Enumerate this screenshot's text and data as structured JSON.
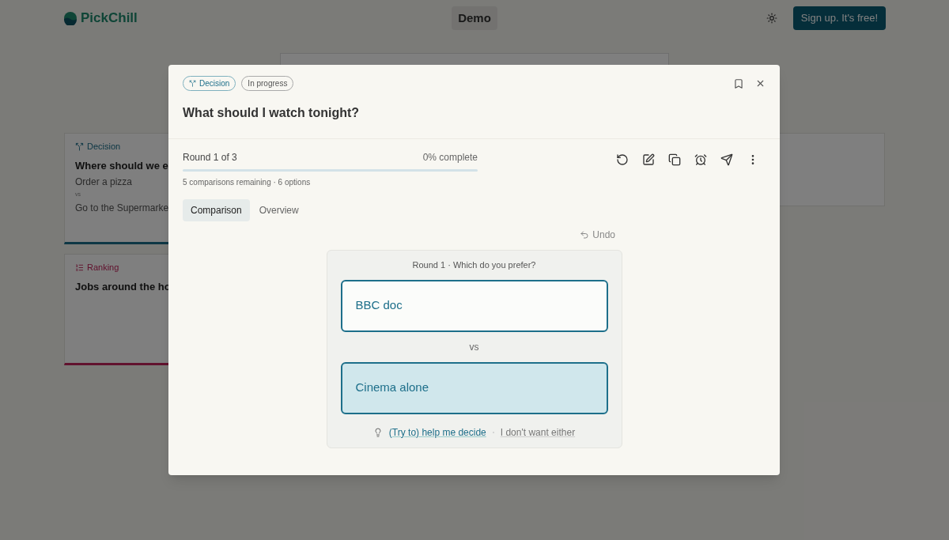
{
  "header": {
    "logo": "PickChill",
    "title": "Demo",
    "signup": "Sign up. It's free!"
  },
  "background_cards": [
    {
      "kind": "decision",
      "tag": "Decision",
      "title": "Where should we e",
      "lines": [
        "Order a pizza",
        "vs",
        "Go to the Supermarke"
      ]
    },
    {
      "kind": "ranking",
      "tag": "Ranking",
      "title": "Jobs around the ho"
    }
  ],
  "modal": {
    "tags": [
      {
        "kind": "decision",
        "label": "Decision"
      },
      {
        "kind": "status",
        "label": "In progress"
      }
    ],
    "title": "What should I watch tonight?",
    "progress": {
      "round": "Round 1 of 3",
      "complete": "0% complete",
      "level": 0,
      "detail": "5 comparisons remaining · 6 options"
    },
    "tabs": [
      {
        "label": "Comparison",
        "selected": true
      },
      {
        "label": "Overview",
        "selected": false
      }
    ],
    "undo": "Undo",
    "comparison": {
      "prompt": "Round 1 · Which do you prefer?",
      "options": [
        {
          "label": "BBC doc",
          "selected": false
        },
        {
          "label": "Cinema alone",
          "selected": true
        }
      ],
      "separator": "vs",
      "help": "(Try to) help me decide",
      "skip": "I don't want either"
    }
  }
}
